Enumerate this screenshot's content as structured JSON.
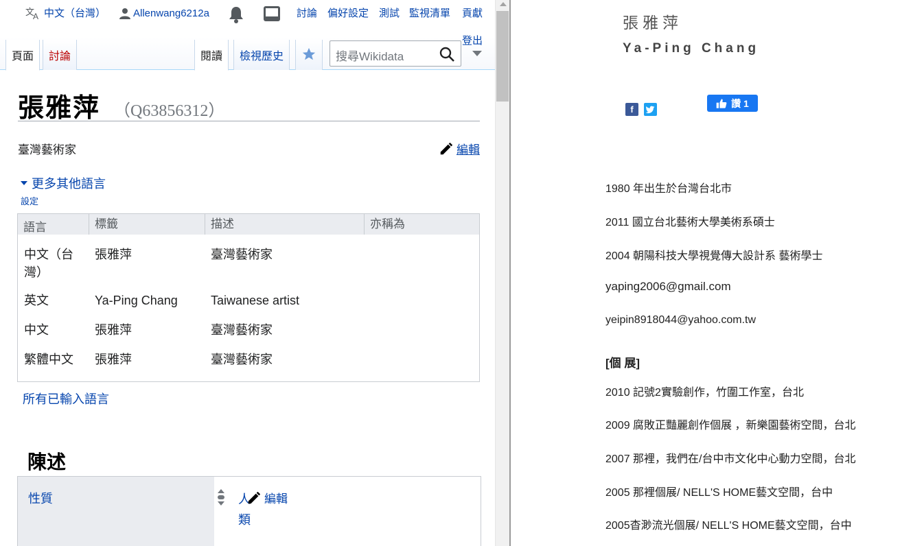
{
  "left": {
    "personal": {
      "language": "中文（台灣）",
      "username": "Allenwang6212a",
      "links": [
        "討論",
        "偏好設定",
        "測試",
        "監視清單",
        "貢獻"
      ],
      "logout": "登出"
    },
    "tabs": {
      "page": "頁面",
      "talk": "討論",
      "read": "閱讀",
      "history": "檢視歷史"
    },
    "search": {
      "placeholder": "搜尋Wikidata"
    },
    "title": "張雅萍",
    "qid": "（Q63856312）",
    "description": "臺灣藝術家",
    "edit_label": "編輯",
    "more_languages": "更多其他語言",
    "settings": "設定",
    "lang_table": {
      "headers": [
        "語言",
        "標籤",
        "描述",
        "亦稱為"
      ],
      "rows": [
        {
          "lang": "中文（台灣）",
          "label": "張雅萍",
          "desc": "臺灣藝術家",
          "alias": ""
        },
        {
          "lang": "英文",
          "label": "Ya-Ping Chang",
          "desc": "Taiwanese artist",
          "alias": ""
        },
        {
          "lang": "中文",
          "label": "張雅萍",
          "desc": "臺灣藝術家",
          "alias": ""
        },
        {
          "lang": "繁體中文",
          "label": "張雅萍",
          "desc": "臺灣藝術家",
          "alias": ""
        }
      ]
    },
    "all_languages": "所有已輸入語言",
    "statements": {
      "heading": "陳述",
      "property": "性質",
      "value": "人類",
      "edit_label": "編輯"
    }
  },
  "right": {
    "name_zh": "張雅萍",
    "name_en": "Ya-Ping Chang",
    "like_label": "讚 1",
    "lines": [
      "1980 年出生於台灣台北市",
      "2011 國立台北藝術大學美術系碩士",
      "2004 朝陽科技大學視覺傳大設計系 藝術學士",
      "yaping2006@gmail.com",
      "yeipin8918044@yahoo.com.tw",
      "[個 展]",
      "2010 記號2實驗創作，竹圍工作室，台北",
      "2009 腐敗正豔麗創作個展 ，新樂園藝術空間，台北",
      "2007 那裡，我們在/台中市文化中心動力空間，台北",
      "2005 那裡個展/ NELL'S HOME藝文空間，台中",
      "2005杳渺流光個展/ NELL'S HOME藝文空間，台中"
    ]
  },
  "colors": {
    "link": "#0645ad",
    "new_link": "#ba0000",
    "facebook": "#3b5998",
    "twitter": "#1da1f2",
    "fb_like": "#1877f2"
  },
  "icons": [
    "translate-icon",
    "user-icon",
    "bell-icon",
    "inbox-icon",
    "star-icon",
    "search-icon",
    "pencil-icon",
    "rank-icon",
    "facebook-icon",
    "twitter-icon",
    "thumbs-up-icon"
  ]
}
